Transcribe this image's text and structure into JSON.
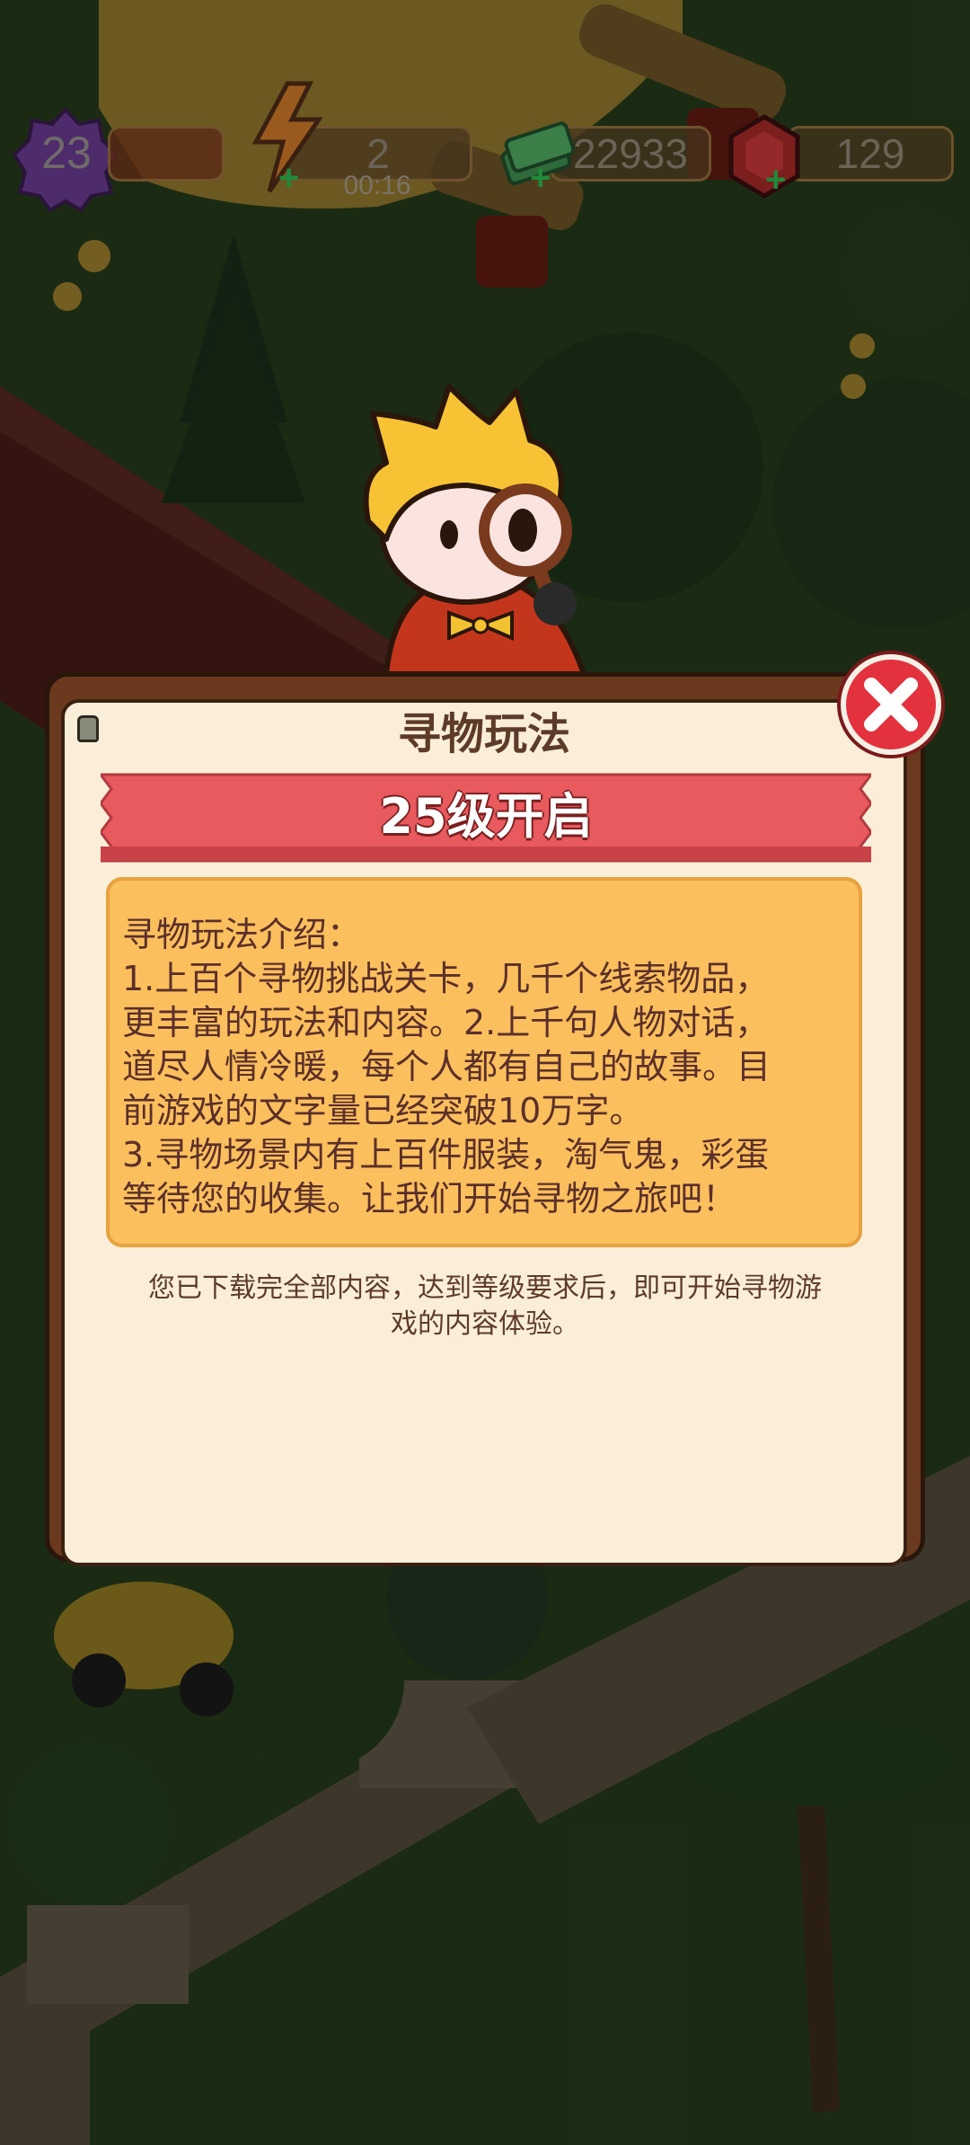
{
  "hud": {
    "level": "23",
    "energy": "2",
    "energy_timer": "00:16",
    "cash": "22933",
    "gems": "129"
  },
  "icons": {
    "level": "level-badge-icon",
    "energy": "lightning-icon",
    "cash": "cash-stack-icon",
    "gems": "ruby-gem-icon",
    "close": "close-x-icon"
  },
  "dialog": {
    "title": "寻物玩法",
    "unlock_label": "25级开启",
    "intro_heading": "寻物玩法介绍：",
    "intro_body": "1.上百个寻物挑战关卡，几千个线索物品，\n更丰富的玩法和内容。2.上千句人物对话，\n道尽人情冷暖，每个人都有自己的故事。目\n前游戏的文字量已经突破10万字。\n3.寻物场景内有上百件服装，淘气鬼，彩蛋\n等待您的收集。让我们开始寻物之旅吧！",
    "note": "您已下载完全部内容，达到等级要求后，即可开始寻物游\n戏的内容体验。"
  },
  "colors": {
    "ribbon": "#e85a5e",
    "info_box": "#fbbf5d",
    "panel": "#fbeed8",
    "frame": "#6b3a1e",
    "close_button": "#e3323e"
  }
}
